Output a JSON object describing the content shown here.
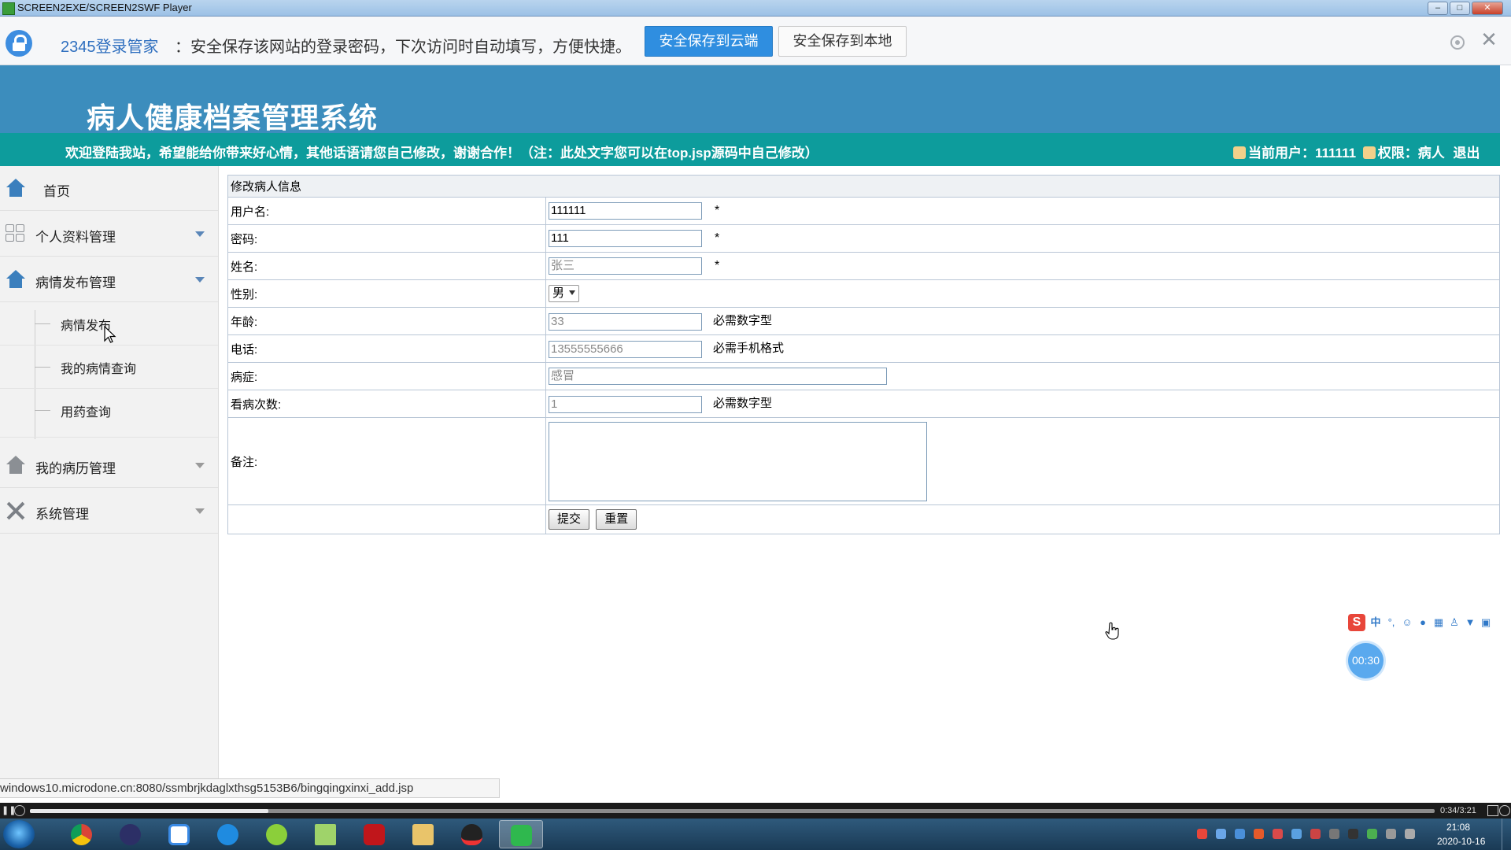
{
  "window": {
    "title": "SCREEN2EXE/SCREEN2SWF Player",
    "minimize_icon": "minimize-icon",
    "maximize_icon": "maximize-icon",
    "close_label": "✕"
  },
  "password_bar": {
    "brand": "2345登录管家",
    "message": "：安全保存该网站的登录密码，下次访问时自动填写，方便快捷。",
    "save_cloud_label": "安全保存到云端",
    "save_local_label": "安全保存到本地",
    "close_label": "✕",
    "accent_color": "#2f8ee0"
  },
  "header": {
    "title": "病人健康档案管理系统",
    "welcome": "欢迎登陆我站，希望能给你带来好心情，其他话语请您自己修改，谢谢合作！（注：此处文字您可以在top.jsp源码中自己修改）",
    "current_user_label": "当前用户：",
    "current_user": "111111",
    "role_label": "权限：",
    "role": "病人",
    "logout": "退出",
    "bg_color": "#3c8dbd",
    "welcome_bg_color": "#0d9c9c"
  },
  "sidebar": {
    "items": [
      {
        "label": "首页",
        "icon": "home-icon"
      },
      {
        "label": "个人资料管理",
        "icon": "grid-icon"
      },
      {
        "label": "病情发布管理",
        "icon": "home-icon"
      },
      {
        "label": "我的病历管理",
        "icon": "home-icon"
      },
      {
        "label": "系统管理",
        "icon": "tools-icon"
      }
    ],
    "subitems": [
      {
        "label": "病情发布"
      },
      {
        "label": "我的病情查询"
      },
      {
        "label": "用药查询"
      }
    ]
  },
  "form": {
    "title": "修改病人信息",
    "fields": {
      "username": {
        "label": "用户名:",
        "value": "111111",
        "required": "*"
      },
      "password": {
        "label": "密码:",
        "value": "111",
        "required": "*"
      },
      "name": {
        "label": "姓名:",
        "value": "张三",
        "required": "*"
      },
      "gender": {
        "label": "性别:",
        "value": "男"
      },
      "age": {
        "label": "年龄:",
        "value": "33",
        "hint": "必需数字型"
      },
      "phone": {
        "label": "电话:",
        "value": "13555555666",
        "hint": "必需手机格式"
      },
      "disease": {
        "label": "病症:",
        "value": "感冒"
      },
      "visits": {
        "label": "看病次数:",
        "value": "1",
        "hint": "必需数字型"
      },
      "remark": {
        "label": "备注:",
        "value": ""
      }
    },
    "submit_label": "提交",
    "reset_label": "重置"
  },
  "status_url": "windows10.microdone.cn:8080/ssmbrjkdaglxthsg5153B6/bingqingxinxi_add.jsp",
  "ime": {
    "logo": "S",
    "mode": "中",
    "timer": "00:30"
  },
  "player": {
    "time": "0:34/3:21",
    "progress": 0.17
  },
  "taskbar": {
    "apps": [
      "chrome-icon",
      "terminal-icon",
      "baidu-netdisk-icon",
      "browser-icon",
      "tool-icon",
      "notepad-icon",
      "flash-icon",
      "explorer-icon",
      "qq-icon",
      "player-icon"
    ],
    "clock_time": "21:08",
    "clock_date": "2020-10-16"
  }
}
